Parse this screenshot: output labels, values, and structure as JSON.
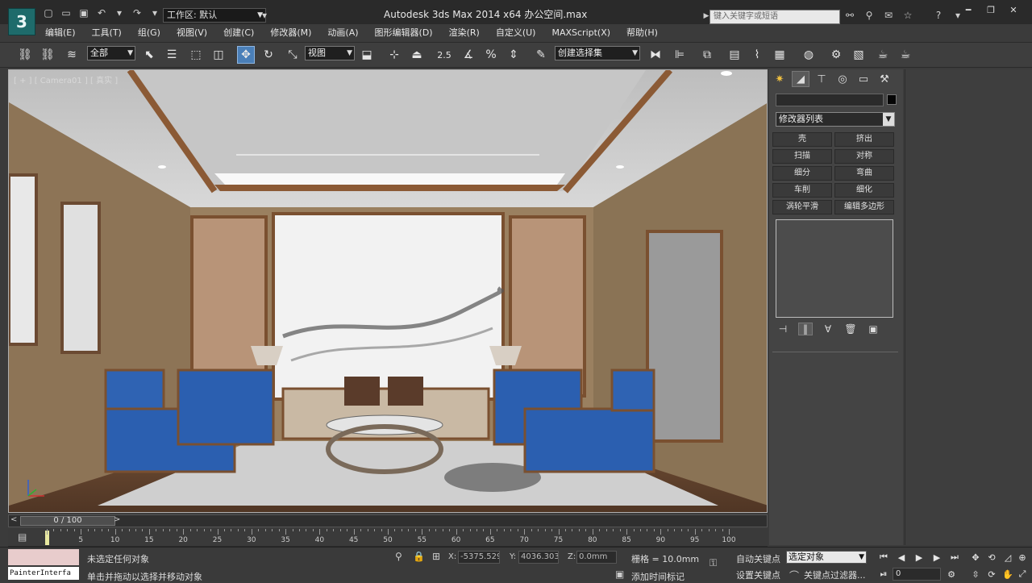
{
  "title_bar": {
    "logo_letter": "3",
    "workspace": "工作区: 默认",
    "app_title": "Autodesk 3ds Max  2014 x64      办公空间.max",
    "search_placeholder": "键入关键字或短语"
  },
  "menu": [
    "编辑(E)",
    "工具(T)",
    "组(G)",
    "视图(V)",
    "创建(C)",
    "修改器(M)",
    "动画(A)",
    "图形编辑器(D)",
    "渲染(R)",
    "自定义(U)",
    "MAXScript(X)",
    "帮助(H)"
  ],
  "toolbar": {
    "selection_filter": "全部",
    "ref_coord": "视图",
    "angle_snap_label": "2.5",
    "named_selection": "创建选择集"
  },
  "viewport": {
    "label": "[ + ] [ Camera01 ] [ 真实 ]"
  },
  "command_panel": {
    "modifier_list": "修改器列表",
    "buttons": [
      "壳",
      "挤出",
      "扫描",
      "对称",
      "细分",
      "弯曲",
      "车削",
      "细化",
      "涡轮平滑",
      "编辑多边形"
    ]
  },
  "time_slider": {
    "position": "0 / 100",
    "prev": "<",
    "next": ">",
    "ticks": [
      "5",
      "10",
      "15",
      "20",
      "25",
      "30",
      "35",
      "40",
      "45",
      "50",
      "55",
      "60",
      "65",
      "70",
      "75",
      "80",
      "85",
      "90",
      "95",
      "100"
    ]
  },
  "status": {
    "listener_text": "PainterInterfa",
    "selection_message": "未选定任何对象",
    "prompt": "单击并拖动以选择并移动对象",
    "x_label": "X:",
    "x_value": "-5375.529",
    "y_label": "Y:",
    "y_value": "4036.303",
    "z_label": "Z:",
    "z_value": "0.0mm",
    "grid": "栅格 = 10.0mm",
    "add_time_tag": "添加时间标记",
    "auto_key": "自动关键点",
    "set_key": "设置关键点",
    "selected_set": "选定对象",
    "key_filters": "关键点过滤器...",
    "frame": "0"
  }
}
